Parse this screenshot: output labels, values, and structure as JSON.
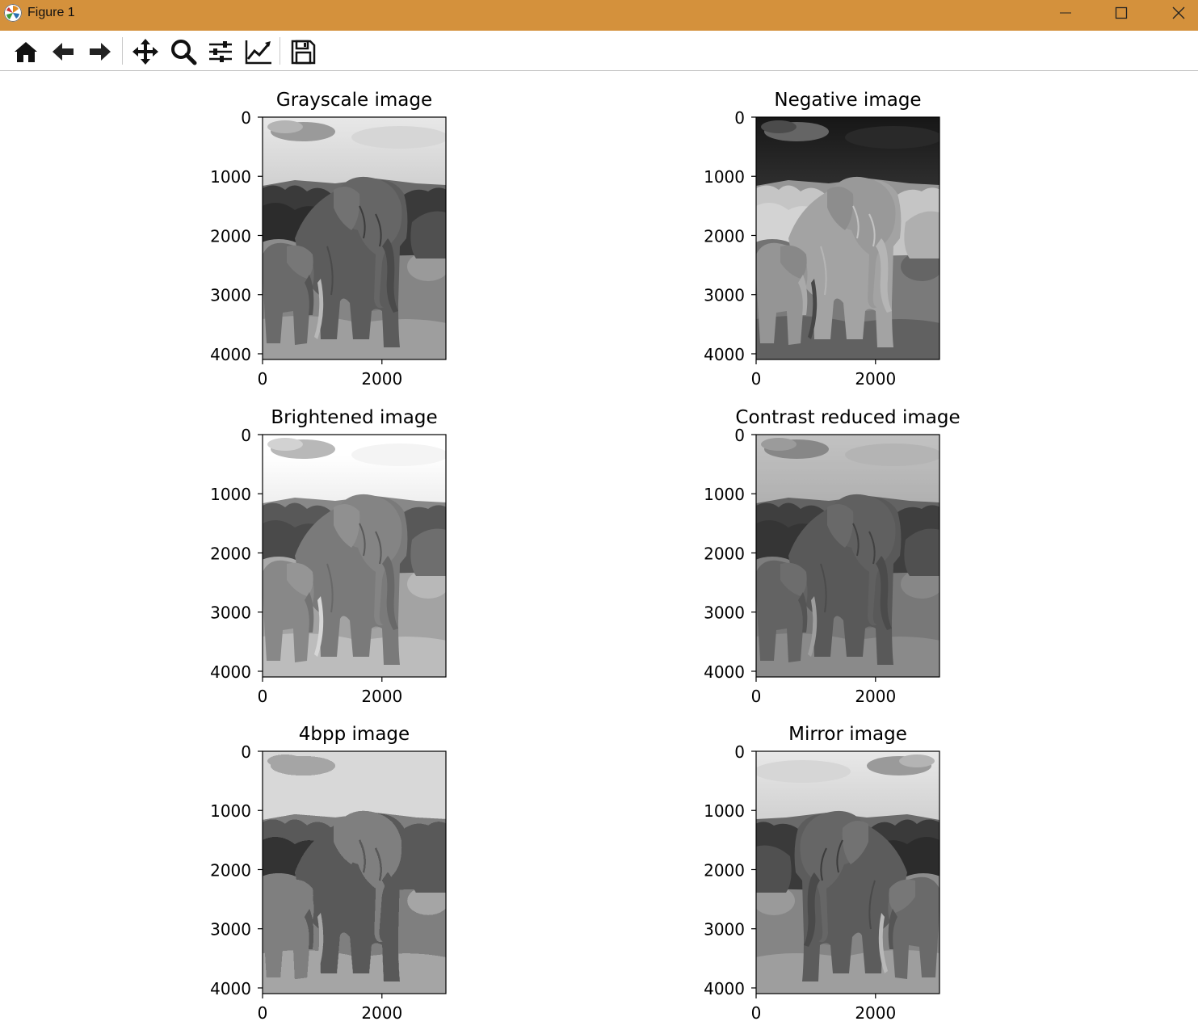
{
  "window": {
    "title": "Figure 1"
  },
  "toolbar": {
    "tools": [
      "home-icon",
      "back-arrow-icon",
      "forward-arrow-icon",
      "pan-icon",
      "zoom-icon",
      "configure-subplots-icon",
      "edit-axes-icon",
      "save-icon"
    ]
  },
  "subplots": [
    {
      "title": "Grayscale image",
      "variant": "gray"
    },
    {
      "title": "Negative image",
      "variant": "negative"
    },
    {
      "title": "Brightened image",
      "variant": "bright"
    },
    {
      "title": "Contrast reduced image",
      "variant": "lowcontrast"
    },
    {
      "title": "4bpp image",
      "variant": "posterized"
    },
    {
      "title": "Mirror image",
      "variant": "mirror"
    }
  ],
  "axes": {
    "y_ticks": [
      "0",
      "1000",
      "2000",
      "3000",
      "4000"
    ],
    "x_ticks": [
      "0",
      "2000"
    ],
    "x_range": [
      0,
      3072
    ],
    "y_range": [
      0,
      4096
    ]
  },
  "colors": {
    "titlebar": "#d4913c",
    "toolbar_bg": "#ffffff"
  }
}
